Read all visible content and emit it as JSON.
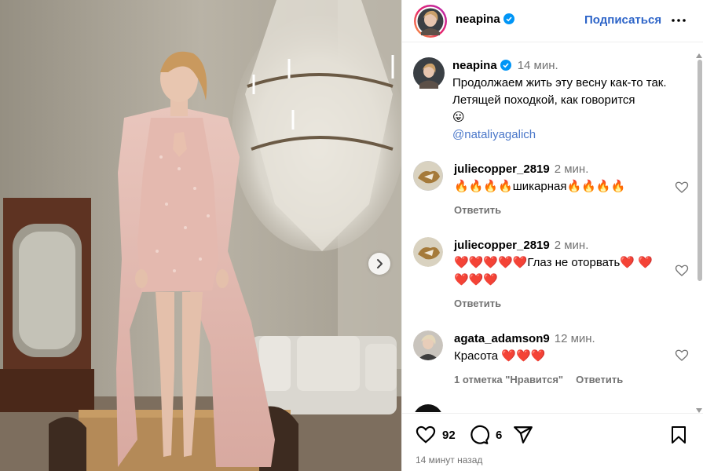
{
  "post": {
    "username": "neapina",
    "follow_label": "Подписаться",
    "likes": "92",
    "comments_count": "6",
    "posted_ago": "14 минут назад"
  },
  "caption": {
    "username": "neapina",
    "time": "14 мин.",
    "text": "Продолжаем жить эту весну как-то так. Летящей походкой, как говорится",
    "emoji": "😛",
    "mention": "@nataliyagalich"
  },
  "comments": [
    {
      "username": "juliecopper_2819",
      "time": "2 мин.",
      "text": "🔥🔥🔥🔥шикарная🔥🔥🔥🔥",
      "reply_label": "Ответить"
    },
    {
      "username": "juliecopper_2819",
      "time": "2 мин.",
      "text": "❤️❤️❤️❤️❤️Глаз не оторвать❤️ ❤️❤️❤️❤️",
      "reply_label": "Ответить"
    },
    {
      "username": "agata_adamson9",
      "time": "12 мин.",
      "text": "Красота ❤️❤️❤️",
      "likes_label": "1 отметка \"Нравится\"",
      "reply_label": "Ответить"
    }
  ],
  "colors": {
    "link": "#2d64c8",
    "verified": "#0095f6",
    "muted": "#737373",
    "heart_red": "#ed1c24"
  },
  "icons": [
    "verified-badge-icon",
    "more-options-icon",
    "like-icon",
    "comment-icon",
    "share-icon",
    "save-icon",
    "next-image-icon"
  ]
}
